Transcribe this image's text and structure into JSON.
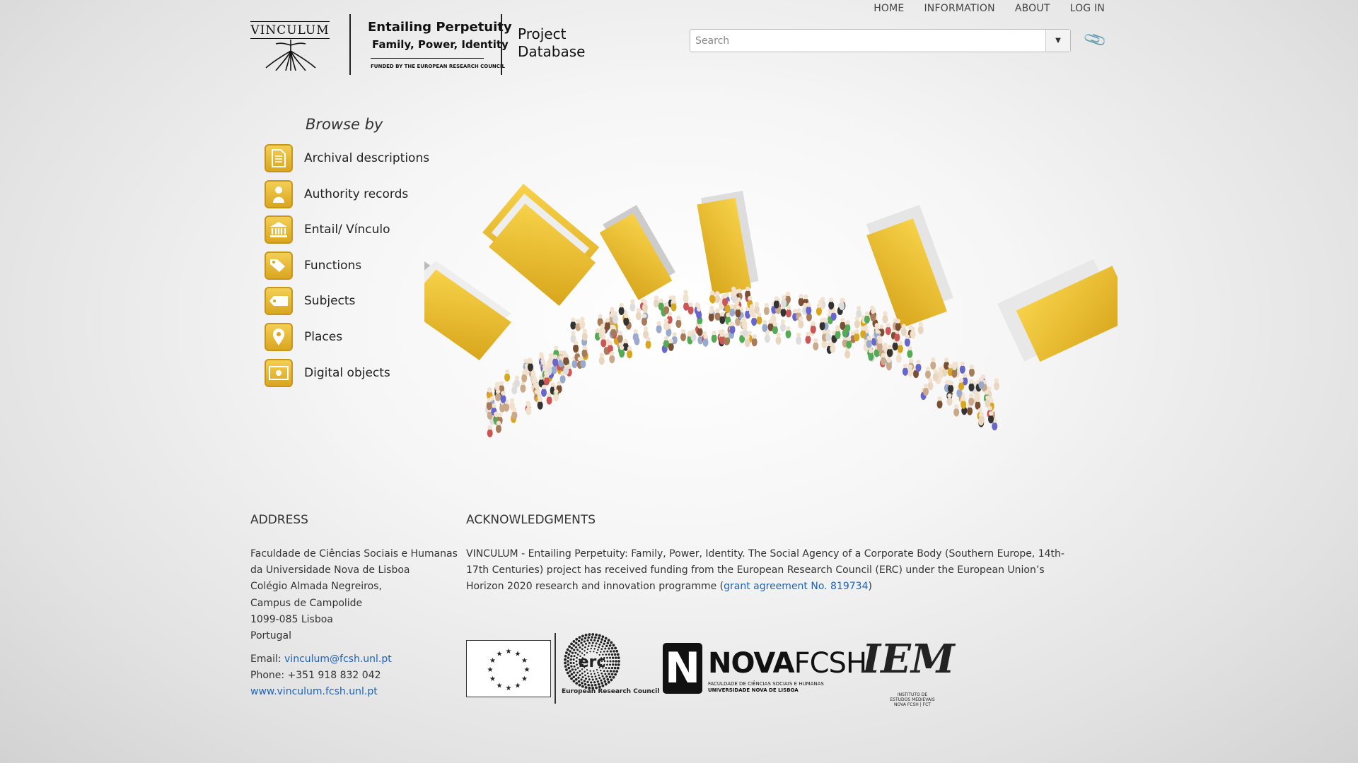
{
  "header": {
    "logo_vinculum": "VINCULUM",
    "logo_title": "Entailing Perpetuity",
    "logo_subtitle": "Family, Power, Identity",
    "logo_funded": "FUNDED BY THE EUROPEAN RESEARCH COUNCIL",
    "project_line1": "Project",
    "project_line2": "Database"
  },
  "nav": {
    "home": "HOME",
    "information": "INFORMATION",
    "about": "ABOUT",
    "login": "LOG IN"
  },
  "search": {
    "placeholder": "Search",
    "value": ""
  },
  "browse": {
    "title": "Browse by",
    "items": [
      {
        "label": "Archival descriptions",
        "icon": "document-icon"
      },
      {
        "label": "Authority records",
        "icon": "person-icon"
      },
      {
        "label": "Entail/ Vínculo",
        "icon": "institution-icon"
      },
      {
        "label": "Functions",
        "icon": "tags-icon"
      },
      {
        "label": "Subjects",
        "icon": "tag-icon"
      },
      {
        "label": "Places",
        "icon": "map-pin-icon"
      },
      {
        "label": "Digital objects",
        "icon": "image-icon"
      }
    ]
  },
  "footer": {
    "address_heading": "ADDRESS",
    "address_lines": [
      "Faculdade de Ciências Sociais e Humanas",
      "da Universidade Nova de Lisboa",
      "Colégio Almada Negreiros,",
      "Campus de Campolide",
      "1099-085 Lisboa",
      "Portugal"
    ],
    "email_label": "Email:",
    "email": "vinculum@fcsh.unl.pt",
    "phone": "Phone: +351 918 832 042",
    "website": "www.vinculum.fcsh.unl.pt",
    "ack_heading": "ACKNOWLEDGMENTS",
    "ack_text_before": "VINCULUM - Entailing Perpetuity: Family, Power, Identity. The Social Agency of a Corporate Body (Southern Europe, 14th-17th Centuries) project has received funding from the European Research Council (ERC) under the European Union’s Horizon 2020 research and innovation programme (",
    "ack_link": "grant agreement No. 819734",
    "ack_text_after": ")"
  },
  "sponsors": {
    "erc_label": "European Research Council",
    "nova_n": "N",
    "nova_bold": "NOVA",
    "nova_light": "FCSH",
    "nova_sub1": "FACULDADE DE CIÊNCIAS SOCIAIS E HUMANAS",
    "nova_sub2": "UNIVERSIDADE NOVA DE LISBOA",
    "iem": "IEM",
    "iem_sub": "INSTITUTO DE ESTUDOS MEDIEVAIS NOVA FCSH | FCT"
  },
  "colors": {
    "accent_gold": "#e0b12a",
    "link_blue": "#1a63b8"
  }
}
